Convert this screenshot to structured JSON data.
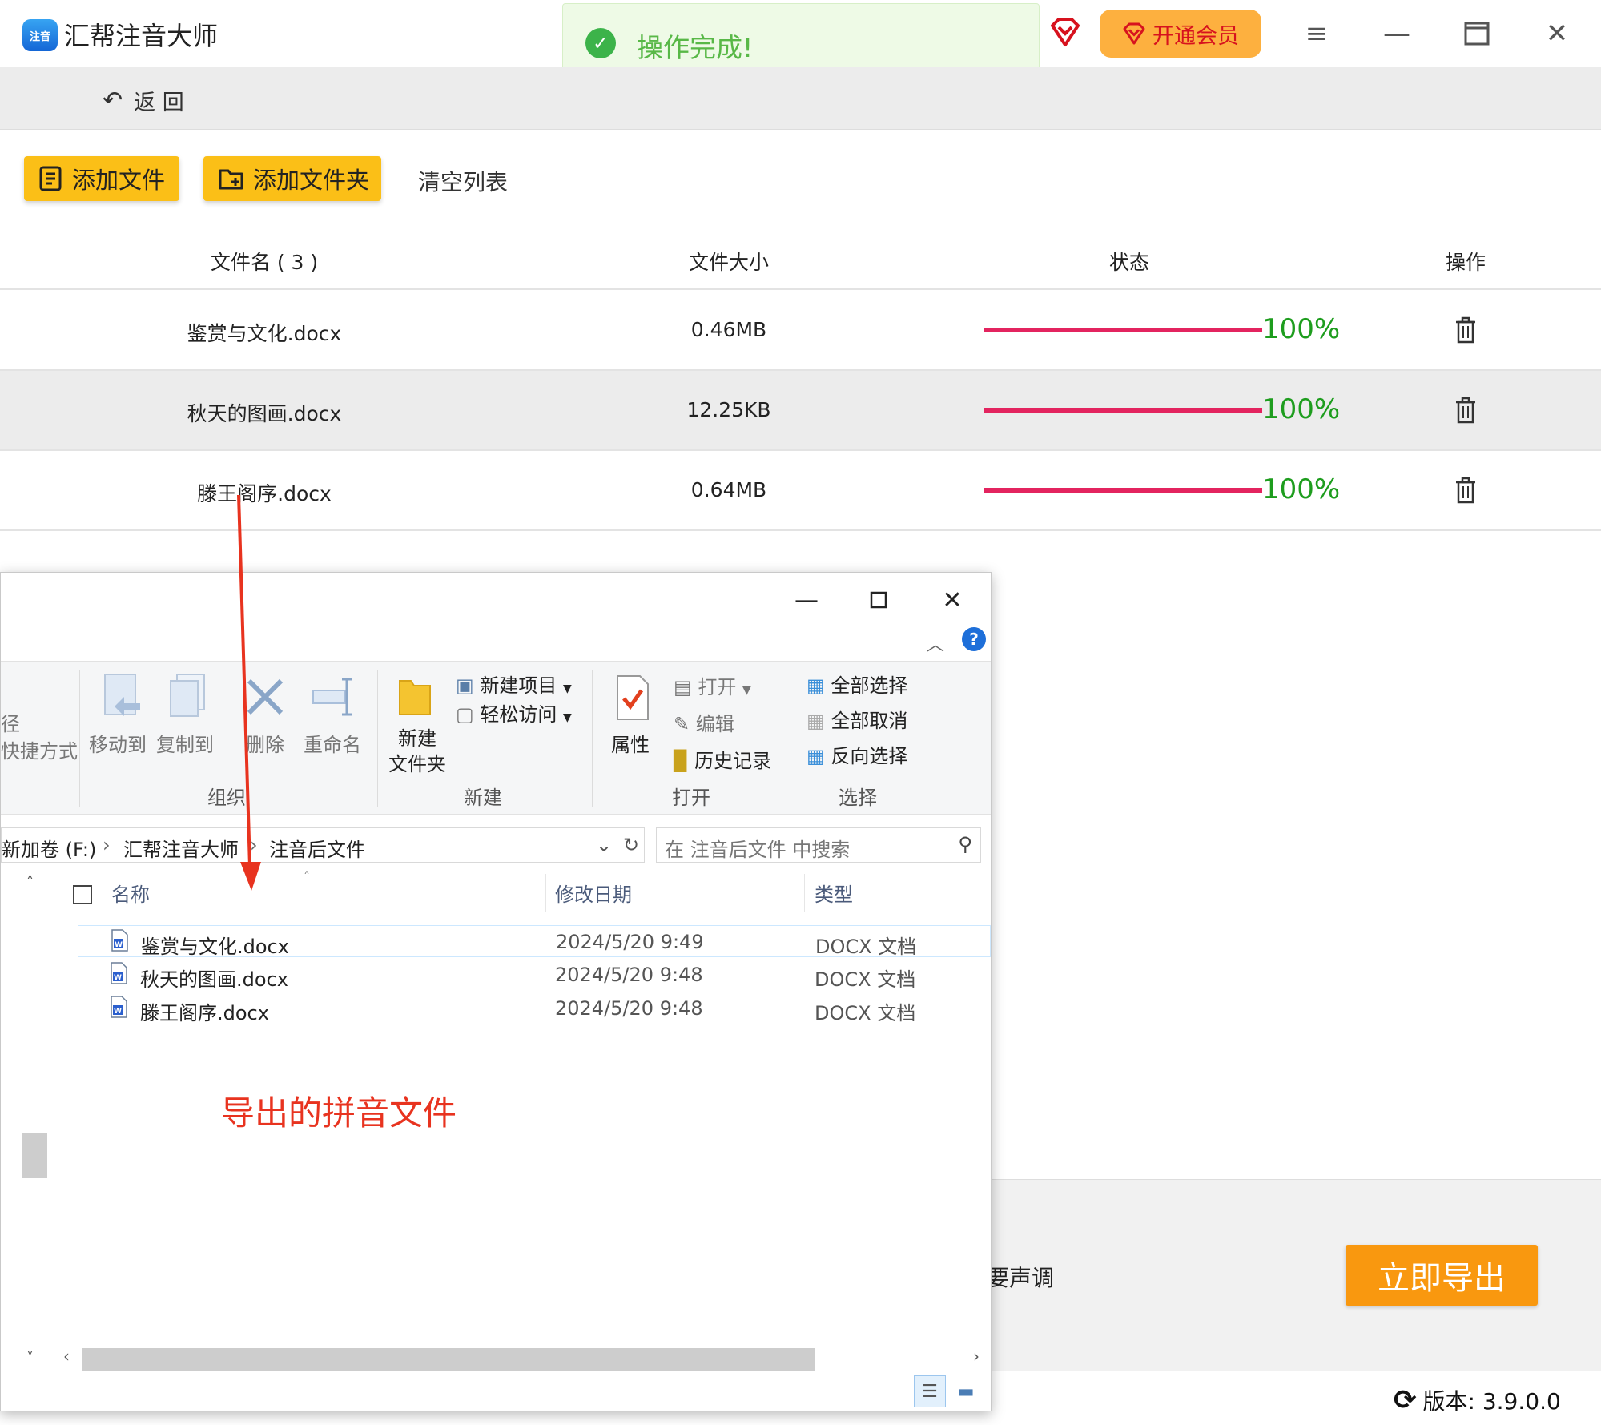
{
  "app": {
    "logo_text": "注音",
    "title": "汇帮注音大师",
    "toast_text": "操作完成!",
    "vip_label": "开通会员",
    "back_label": "返 回",
    "colors": {
      "accent": "#fbbf17",
      "progress": "#e3245f",
      "success": "#1e9d1e",
      "export": "#f9980f"
    }
  },
  "toolbar": {
    "add_file": "添加文件",
    "add_folder": "添加文件夹",
    "clear_list": "清空列表"
  },
  "table": {
    "headers": {
      "name": "文件名 ( 3 )",
      "size": "文件大小",
      "status": "状态",
      "action": "操作"
    },
    "rows": [
      {
        "name": "鉴赏与文化.docx",
        "size": "0.46MB",
        "progress": 100,
        "progress_label": "100%"
      },
      {
        "name": "秋天的图画.docx",
        "size": "12.25KB",
        "progress": 100,
        "progress_label": "100%"
      },
      {
        "name": "滕王阁序.docx",
        "size": "0.64MB",
        "progress": 100,
        "progress_label": "100%"
      }
    ]
  },
  "bottom": {
    "tone_text": "声调",
    "tone_prefix": "要",
    "export_label": "立即导出",
    "version_label": "版本: 3.9.0.0"
  },
  "explorer": {
    "ribbon": {
      "path_partial": "径",
      "shortcut_partial": "快捷方式",
      "move_to": "移动到",
      "copy_to": "复制到",
      "delete": "删除",
      "rename": "重命名",
      "new_folder": "新建\n文件夹",
      "new_item": "新建项目",
      "easy_access": "轻松访问",
      "properties": "属性",
      "open": "打开",
      "edit": "编辑",
      "history": "历史记录",
      "select_all": "全部选择",
      "select_none": "全部取消",
      "invert_select": "反向选择",
      "groups": {
        "organize": "组织",
        "new": "新建",
        "open": "打开",
        "select": "选择"
      }
    },
    "address": {
      "part1": "新加卷 (F:)",
      "part2": "汇帮注音大师",
      "part3": "注音后文件"
    },
    "search_placeholder": "在 注音后文件 中搜索",
    "columns": {
      "name": "名称",
      "modified": "修改日期",
      "type": "类型"
    },
    "files": [
      {
        "name": "鉴赏与文化.docx",
        "modified": "2024/5/20 9:49",
        "type": "DOCX 文档"
      },
      {
        "name": "秋天的图画.docx",
        "modified": "2024/5/20 9:48",
        "type": "DOCX 文档"
      },
      {
        "name": "滕王阁序.docx",
        "modified": "2024/5/20 9:48",
        "type": "DOCX 文档"
      }
    ],
    "annotation": "导出的拼音文件"
  }
}
